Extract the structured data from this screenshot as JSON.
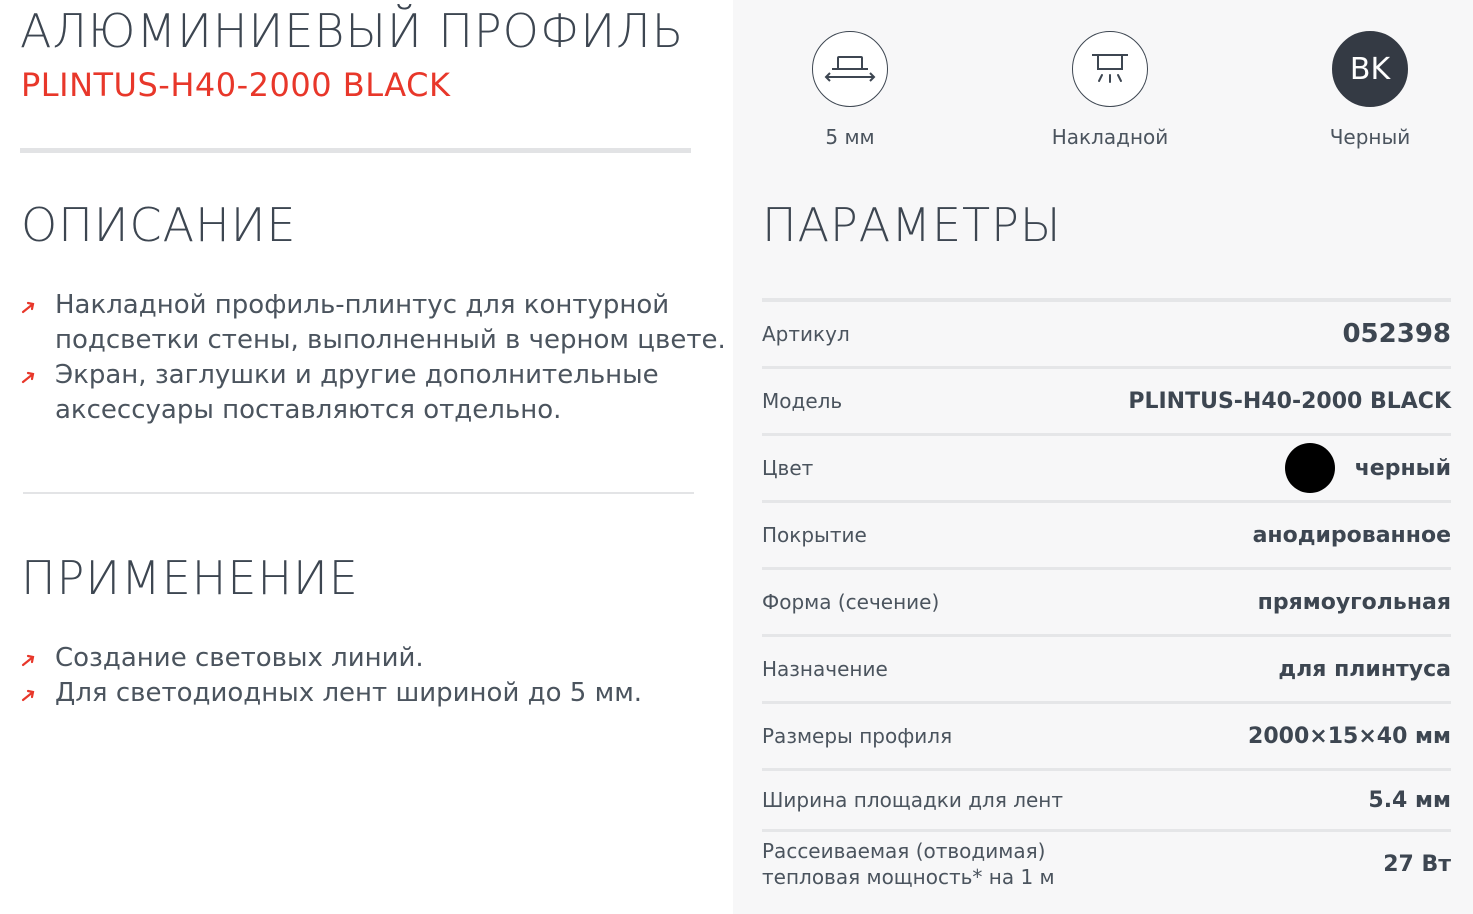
{
  "product": {
    "type": "АЛЮМИНИЕВЫЙ ПРОФИЛЬ",
    "model": "PLINTUS-H40-2000 BLACK"
  },
  "features": [
    {
      "icon": "profile-width-icon",
      "label": "5 мм"
    },
    {
      "icon": "surface-mount-icon",
      "label": "Накладной"
    },
    {
      "icon": "color-code-icon",
      "badge": "BK",
      "label": "Черный"
    }
  ],
  "description": {
    "title": "ОПИСАНИЕ",
    "items": [
      [
        "Накладной профиль-плинтус для контурной",
        "подсветки стены, выполненный в черном цвете."
      ],
      [
        "Экран, заглушки и другие дополнительные",
        "аксессуары поставляются отдельно."
      ]
    ]
  },
  "application": {
    "title": "ПРИМЕНЕНИЕ",
    "items": [
      [
        "Создание световых линий."
      ],
      [
        "Для светодиодных лент шириной до 5 мм."
      ]
    ]
  },
  "params": {
    "title": "ПАРАМЕТРЫ",
    "rows": [
      {
        "key": "Артикул",
        "value": "052398"
      },
      {
        "key": "Модель",
        "value": "PLINTUS-H40-2000 BLACK"
      },
      {
        "key": "Цвет",
        "value": "черный",
        "swatch": "#000000"
      },
      {
        "key": "Покрытие",
        "value": "анодированное"
      },
      {
        "key": "Форма (сечение)",
        "value": "прямоугольная"
      },
      {
        "key": "Назначение",
        "value": "для плинтуса"
      },
      {
        "key": "Размеры профиля",
        "value": "2000×15×40 мм"
      },
      {
        "key": "Ширина площадки для лент",
        "value": "5.4 мм"
      },
      {
        "key": "Рассеиваемая (отводимая)\nтепловая мощность* на 1 м",
        "value": "27 Вт"
      }
    ]
  },
  "colors": {
    "accent": "#e8372a",
    "text": "#3d4651",
    "panel": "#f7f7f8",
    "badge": "#343a44"
  }
}
